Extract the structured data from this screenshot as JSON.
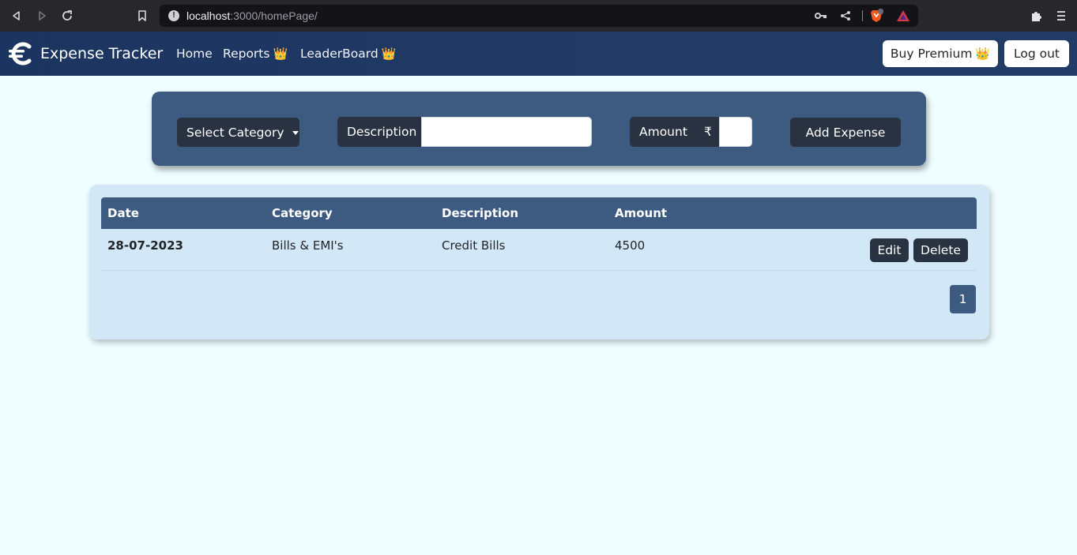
{
  "browser": {
    "url_host": "localhost",
    "url_path": ":3000/homePage/",
    "icons": [
      "back-icon",
      "forward-icon",
      "reload-icon",
      "bookmark-icon",
      "info-icon",
      "key-icon",
      "share-icon",
      "brave-shield-icon",
      "brave-rewards-icon",
      "extensions-icon",
      "menu-icon"
    ]
  },
  "navbar": {
    "brand": "Expense Tracker",
    "links": [
      {
        "label": "Home",
        "crown": ""
      },
      {
        "label": "Reports",
        "crown": "👑"
      },
      {
        "label": "LeaderBoard",
        "crown": "👑"
      }
    ],
    "buy_premium_label": "Buy Premium",
    "buy_premium_crown": "👑",
    "logout_label": "Log out"
  },
  "form": {
    "category_label": "Select Category",
    "description_label": "Description",
    "description_value": "",
    "amount_label": "Amount",
    "currency_symbol": "₹",
    "amount_value": "",
    "add_label": "Add Expense"
  },
  "table": {
    "headers": [
      "Date",
      "Category",
      "Description",
      "Amount"
    ],
    "rows": [
      {
        "date": "28-07-2023",
        "category": "Bills & EMI's",
        "description": "Credit Bills",
        "amount": "4500",
        "edit_label": "Edit",
        "delete_label": "Delete"
      }
    ],
    "page": "1"
  },
  "colors": {
    "page_bg": "#effeff",
    "navbar": "#223a66",
    "card_blue": "#3d5a80",
    "dark_button": "#293241",
    "table_card": "#d3e8f6"
  }
}
